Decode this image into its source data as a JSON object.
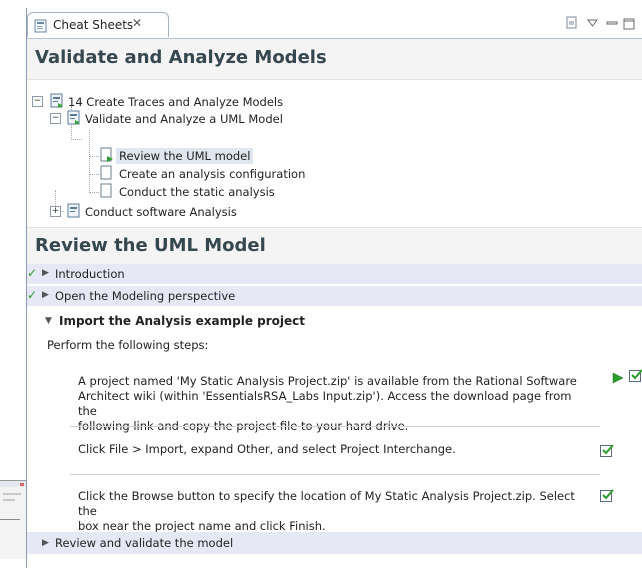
{
  "tab": {
    "label": "Cheat Sheets",
    "close_glyph": "✕"
  },
  "main_title": "Validate and Analyze Models",
  "tree": {
    "root": "14 Create Traces and Analyze Models",
    "group": "Validate and Analyze a UML Model",
    "items": [
      "Review the UML model",
      "Create an analysis configuration",
      "Conduct the static analysis"
    ],
    "other": "Conduct software Analysis",
    "expanded_glyph": "−",
    "collapsed_glyph": "+"
  },
  "section_title": "Review the UML Model",
  "section_items": [
    {
      "label": "Introduction",
      "completed": true
    },
    {
      "label": "Open the Modeling perspective",
      "completed": true
    },
    {
      "label": "Import the Analysis example project",
      "completed": false
    }
  ],
  "glyphs": {
    "check": "✓",
    "collapsed": "▶",
    "expanded": "▼"
  },
  "intro_text": "Perform the following steps:",
  "steps": [
    {
      "lines": [
        "A project named 'My Static Analysis Project.zip' is available from the Rational Software",
        "Architect wiki (within 'EssentialsRSA_Labs Input.zip'). Access the download page from the",
        "following link and copy the project file to your hard drive."
      ]
    },
    {
      "lines": [
        "Click File > Import, expand Other, and select Project Interchange."
      ]
    },
    {
      "lines": [
        "Click the Browse button to specify the location of My Static Analysis Project.zip. Select the",
        "box near the project name and click Finish."
      ]
    }
  ],
  "last_item": "Review and validate the model",
  "colors": {
    "title": "#37474f",
    "row_bg": "#e7e8f5",
    "check_green": "#2e9a2e",
    "play_green": "#2a9d2a"
  },
  "icons": [
    "cheatsheet-icon",
    "minimize-icon",
    "view-menu-icon",
    "maximize-icon",
    "run-step-icon",
    "complete-step-icon"
  ]
}
